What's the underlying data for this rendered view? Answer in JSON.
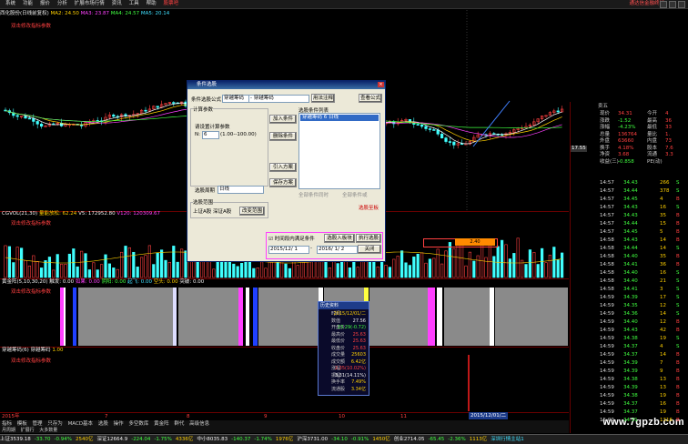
{
  "menu": {
    "items": [
      "系统",
      "功能",
      "报价",
      "分析",
      "扩展市场行情",
      "资讯",
      "工具",
      "帮助",
      "股票吧"
    ],
    "broker": "通达信金融终端"
  },
  "main_indicator": {
    "title": "西化股份(日线前复权)",
    "ma2": "MA2: 24.50",
    "ma3": "MA3: 23.87",
    "ma4": "MA4: 24.57",
    "ma5": "MA5: 20.14"
  },
  "volume_panel": {
    "label": "CGVOL(21,30)",
    "amount": "量能放松: 62.24",
    "v5": "V5: 172952.80",
    "v120": "V120: 120309.67"
  },
  "band_panel": {
    "label": "黄金阵(5,10,30,20)",
    "v1": "触发: 0.00",
    "v2": "如果: 0.00",
    "v3": "阴阳: 0.00",
    "v4": "起飞: 0.00",
    "v5": "空头: 0.00",
    "v6": "突破: 0.00",
    "hint": "双击修改指标参数"
  },
  "bottom_panel": {
    "label": "穿越筹码(6)",
    "name": "穿越筹码",
    "value": "1.00",
    "hint": "双击修改指标参数"
  },
  "main_hint": "双击修改指标参数",
  "vol_marker": "2.40",
  "date_axis": {
    "labels": [
      "2015年",
      "7",
      "8",
      "9",
      "10",
      "11"
    ],
    "current": "2015/12/01/二"
  },
  "tabs": [
    "指标",
    "模板",
    "管理",
    "只存为",
    "MACD基本",
    "选股",
    "操作",
    "多空数库",
    "黄金阵",
    "群代",
    "高级信息"
  ],
  "tabs2": [
    "月周期",
    "扩展行",
    "大多数量"
  ],
  "dialog": {
    "title": "条件选股",
    "formula_label": "条件选股公式",
    "formula_value": "穿越筹码",
    "formula_desc": "- 穿越筹码",
    "btn_usage": "用法注释",
    "btn_view": "查看公式",
    "params_group": "计算参数",
    "params_hint": "请设置计算参数",
    "param_name": "N:",
    "param_value": "6",
    "param_range": "(1.00--100.00)",
    "period_label": "选股周期",
    "period_value": "日线",
    "list_title": "选股条件列表",
    "list_item": "穿越筹码 6 日线",
    "btn_add": "加入条件",
    "btn_delete": "删除条件",
    "btn_load": "引入方案",
    "btn_save": "保存方案",
    "radio_all": "全部条件同时",
    "radio_any": "全部条件或",
    "range_group": "选股范围",
    "range_value": "上证A股 深证A股",
    "btn_change": "改变范围",
    "result_label": "选股至板",
    "checkbox_time": "时间段内满足条件",
    "btn_to_block": "选股入板块",
    "btn_execute": "执行选股",
    "date_from": "2015/12/ 1",
    "date_to": "2016/ 1/ 2",
    "btn_close": "关闭"
  },
  "popup": {
    "title": "历史资料",
    "rows": [
      {
        "k": "时间",
        "v": "2015/12/01/二",
        "c": "#ffd000"
      },
      {
        "k": "数值",
        "v": "27.56",
        "c": "#f0f0f0"
      },
      {
        "k": "开盘价",
        "v": "23.29(-0.72)",
        "c": "#40ff40"
      },
      {
        "k": "最高价",
        "v": "25.63",
        "c": "#ff4040"
      },
      {
        "k": "最低价",
        "v": "25.63",
        "c": "#ff4040"
      },
      {
        "k": "收盘价",
        "v": "25.63",
        "c": "#ff4040"
      },
      {
        "k": "成交量",
        "v": "25603",
        "c": "#ffd000"
      },
      {
        "k": "成交额",
        "v": "6.42亿",
        "c": "#ffd000"
      },
      {
        "k": "涨幅",
        "v": "2.35(10.02%)",
        "c": "#ff4040"
      },
      {
        "k": "振幅",
        "v": "3.31(14.11%)",
        "c": "#f0f0f0"
      },
      {
        "k": "换手率",
        "v": "7.49%",
        "c": "#ffd000"
      },
      {
        "k": "流通股",
        "v": "3.34亿",
        "c": "#ffd000"
      }
    ]
  },
  "right_panel": {
    "sell5": "卖五",
    "rows": [
      {
        "k": "现价",
        "v": "34.31",
        "k2": "今开",
        "v2": "4"
      },
      {
        "k": "涨跌",
        "v": "-1.52",
        "k2": "最高",
        "v2": "36"
      },
      {
        "k": "涨幅",
        "v": "-4.23%",
        "k2": "最低",
        "v2": "33"
      },
      {
        "k": "总量",
        "v": "136764",
        "k2": "量比",
        "v2": "1."
      },
      {
        "k": "外盘",
        "v": "63660",
        "k2": "内盘",
        "v2": "73"
      },
      {
        "k": "换手",
        "v": "4.18%",
        "k2": "股本",
        "v2": "7.6"
      },
      {
        "k": "净资",
        "v": "3.68",
        "k2": "流通",
        "v2": "3.3"
      },
      {
        "k": "收益(三)",
        "v": "-0.858",
        "k2": "PE(动)",
        "v2": ""
      }
    ],
    "price_tag": "17.55",
    "ticks": [
      {
        "t": "14:57",
        "p": "34.43",
        "v": "266",
        "d": "S"
      },
      {
        "t": "14:57",
        "p": "34.44",
        "v": "378",
        "d": "S"
      },
      {
        "t": "14:57",
        "p": "34.45",
        "v": "4",
        "d": "B"
      },
      {
        "t": "14:57",
        "p": "34.43",
        "v": "16",
        "d": "S"
      },
      {
        "t": "14:57",
        "p": "34.43",
        "v": "35",
        "d": "B"
      },
      {
        "t": "14:57",
        "p": "34.44",
        "v": "15",
        "d": "B"
      },
      {
        "t": "14:57",
        "p": "34.45",
        "v": "5",
        "d": "B"
      },
      {
        "t": "14:58",
        "p": "34.43",
        "v": "14",
        "d": "B"
      },
      {
        "t": "14:58",
        "p": "34.44",
        "v": "14",
        "d": "S"
      },
      {
        "t": "14:58",
        "p": "34.40",
        "v": "35",
        "d": "B"
      },
      {
        "t": "14:58",
        "p": "34.41",
        "v": "36",
        "d": "B"
      },
      {
        "t": "14:58",
        "p": "34.40",
        "v": "16",
        "d": "S"
      },
      {
        "t": "14:58",
        "p": "34.40",
        "v": "21",
        "d": "S"
      },
      {
        "t": "14:58",
        "p": "34.41",
        "v": "3",
        "d": "S"
      },
      {
        "t": "14:59",
        "p": "34.39",
        "v": "17",
        "d": "S"
      },
      {
        "t": "14:59",
        "p": "34.35",
        "v": "12",
        "d": "S"
      },
      {
        "t": "14:59",
        "p": "34.36",
        "v": "14",
        "d": "S"
      },
      {
        "t": "14:59",
        "p": "34.40",
        "v": "12",
        "d": "B"
      },
      {
        "t": "14:59",
        "p": "34.43",
        "v": "42",
        "d": "B"
      },
      {
        "t": "14:59",
        "p": "34.38",
        "v": "19",
        "d": "S"
      },
      {
        "t": "14:59",
        "p": "34.37",
        "v": "4",
        "d": "S"
      },
      {
        "t": "14:59",
        "p": "34.37",
        "v": "14",
        "d": "B"
      },
      {
        "t": "14:59",
        "p": "34.39",
        "v": "7",
        "d": "B"
      },
      {
        "t": "14:59",
        "p": "34.39",
        "v": "9",
        "d": "B"
      },
      {
        "t": "14:59",
        "p": "34.38",
        "v": "13",
        "d": "B"
      },
      {
        "t": "14:59",
        "p": "34.39",
        "v": "13",
        "d": "B"
      },
      {
        "t": "14:59",
        "p": "34.38",
        "v": "19",
        "d": "B"
      },
      {
        "t": "14:59",
        "p": "34.37",
        "v": "16",
        "d": "B"
      },
      {
        "t": "14:59",
        "p": "34.37",
        "v": "19",
        "d": "B"
      },
      {
        "t": "15:00",
        "p": "34.31",
        "v": "1316",
        "d": "B"
      }
    ]
  },
  "statusbar": {
    "items": [
      {
        "t": "上证3539.18",
        "c": "#f0f0f0"
      },
      {
        "t": "-33.70",
        "c": "#40ff40"
      },
      {
        "t": "-0.94%",
        "c": "#40ff40"
      },
      {
        "t": "2540亿",
        "c": "#ffd000"
      },
      {
        "t": "深证12664.9",
        "c": "#f0f0f0"
      },
      {
        "t": "-224.04",
        "c": "#40ff40"
      },
      {
        "t": "-1.75%",
        "c": "#40ff40"
      },
      {
        "t": "4336亿",
        "c": "#ffd000"
      },
      {
        "t": "中小8035.83",
        "c": "#f0f0f0"
      },
      {
        "t": "-140.37",
        "c": "#40ff40"
      },
      {
        "t": "-1.74%",
        "c": "#40ff40"
      },
      {
        "t": "1976亿",
        "c": "#ffd000"
      },
      {
        "t": "沪深3731.00",
        "c": "#f0f0f0"
      },
      {
        "t": "-34.10",
        "c": "#40ff40"
      },
      {
        "t": "-0.91%",
        "c": "#40ff40"
      },
      {
        "t": "1450亿",
        "c": "#ffd000"
      },
      {
        "t": "创业2714.05",
        "c": "#f0f0f0"
      },
      {
        "t": "-65.45",
        "c": "#40ff40"
      },
      {
        "t": "-2.36%",
        "c": "#40ff40"
      },
      {
        "t": "1113亿",
        "c": "#ffd000"
      },
      {
        "t": "深圳行情主站1",
        "c": "#40e0ff"
      }
    ]
  },
  "watermark": "www.7gpzb.com",
  "colors": {
    "up": "#ff4040",
    "down": "#40ffff",
    "ma5": "#ffffff",
    "ma10": "#ffd000",
    "ma20": "#ff40ff",
    "ma60": "#40ff40"
  }
}
